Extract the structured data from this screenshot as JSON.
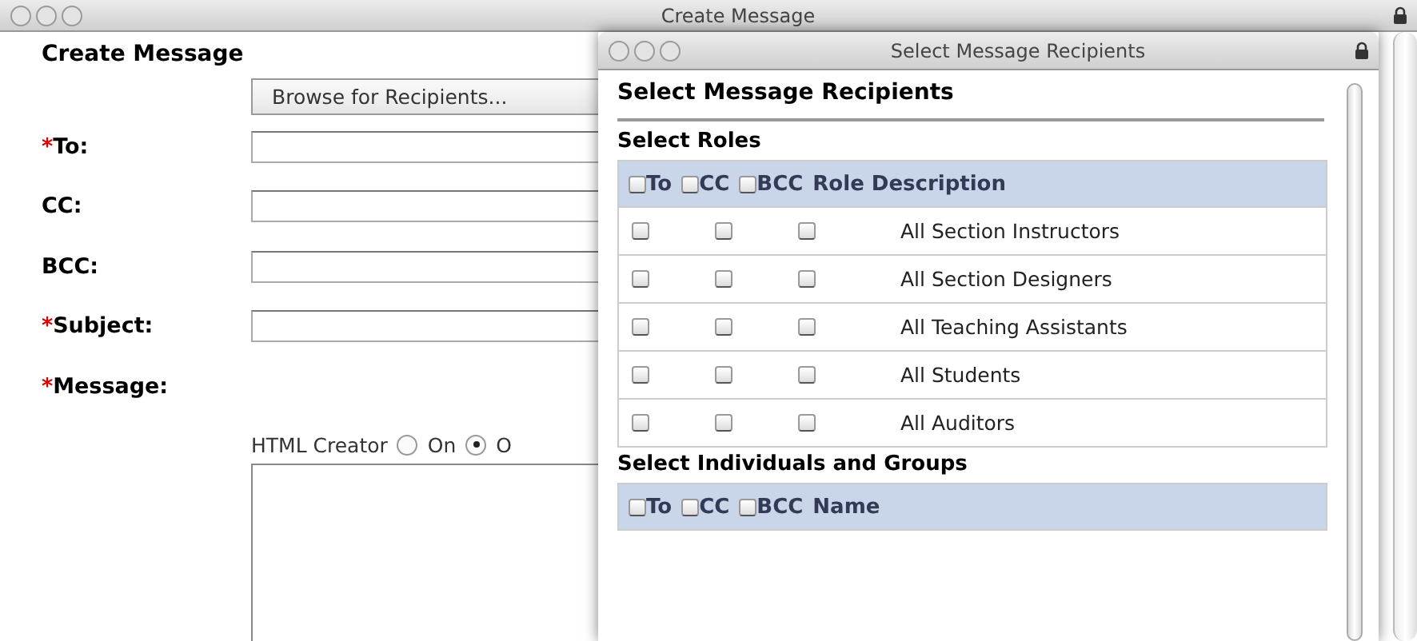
{
  "window": {
    "title": "Create Message"
  },
  "form": {
    "heading": "Create Message",
    "browse_button": "Browse for Recipients...",
    "fields": [
      {
        "label": "To:",
        "required_mark": "*"
      },
      {
        "label": "CC:"
      },
      {
        "label": "BCC:"
      },
      {
        "label": "Subject:",
        "required_mark": "*"
      }
    ],
    "message": {
      "label": "Message:",
      "required_mark": "*"
    },
    "html_creator": {
      "label": "HTML Creator",
      "options": [
        {
          "label": "On",
          "selected": false
        },
        {
          "label": "O",
          "selected": true
        }
      ]
    }
  },
  "dialog": {
    "title": "Select Message Recipients",
    "heading": "Select Message Recipients",
    "roles": {
      "title": "Select Roles",
      "columns": [
        {
          "label": "To",
          "checked": false
        },
        {
          "label": "CC",
          "checked": false
        },
        {
          "label": "BCC",
          "checked": false
        }
      ],
      "last_column": "Role Description",
      "rows": [
        {
          "name": "All Section Instructors",
          "to": false,
          "cc": false,
          "bcc": false
        },
        {
          "name": "All Section Designers",
          "to": false,
          "cc": false,
          "bcc": false
        },
        {
          "name": "All Teaching Assistants",
          "to": false,
          "cc": false,
          "bcc": false
        },
        {
          "name": "All Students",
          "to": false,
          "cc": false,
          "bcc": false
        },
        {
          "name": "All Auditors",
          "to": false,
          "cc": false,
          "bcc": false
        }
      ]
    },
    "individuals": {
      "title": "Select Individuals and Groups",
      "columns": [
        {
          "label": "To",
          "checked": false
        },
        {
          "label": "CC",
          "checked": false
        },
        {
          "label": "BCC",
          "checked": false
        }
      ],
      "last_column": "Name"
    }
  }
}
